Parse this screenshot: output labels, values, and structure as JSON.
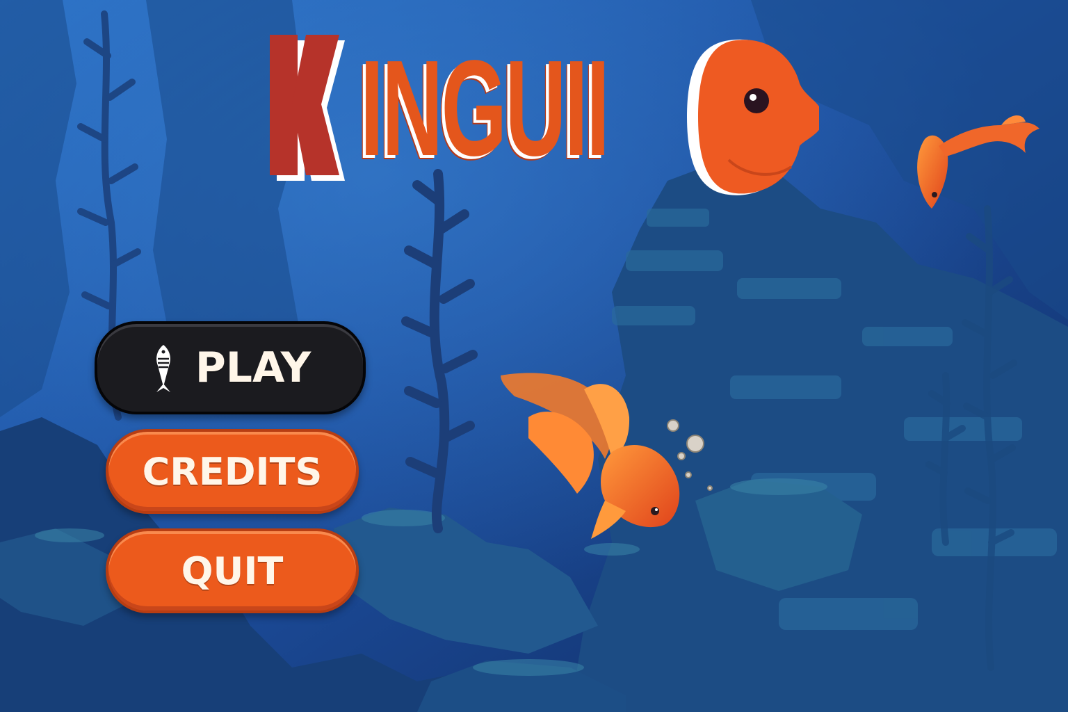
{
  "game": {
    "logo": {
      "first_letter": "K",
      "title_text": "INGUII"
    },
    "menu": {
      "play_label": "PLAY",
      "credits_label": "CREDITS",
      "quit_label": "QUIT"
    },
    "icons": {
      "play_icon": "fish-skeleton-icon"
    },
    "colors": {
      "accent_orange": "#ec5a1c",
      "play_button_bg": "#1b1b1f",
      "water_deep": "#12306b",
      "water_light": "#2a6fc4"
    }
  }
}
